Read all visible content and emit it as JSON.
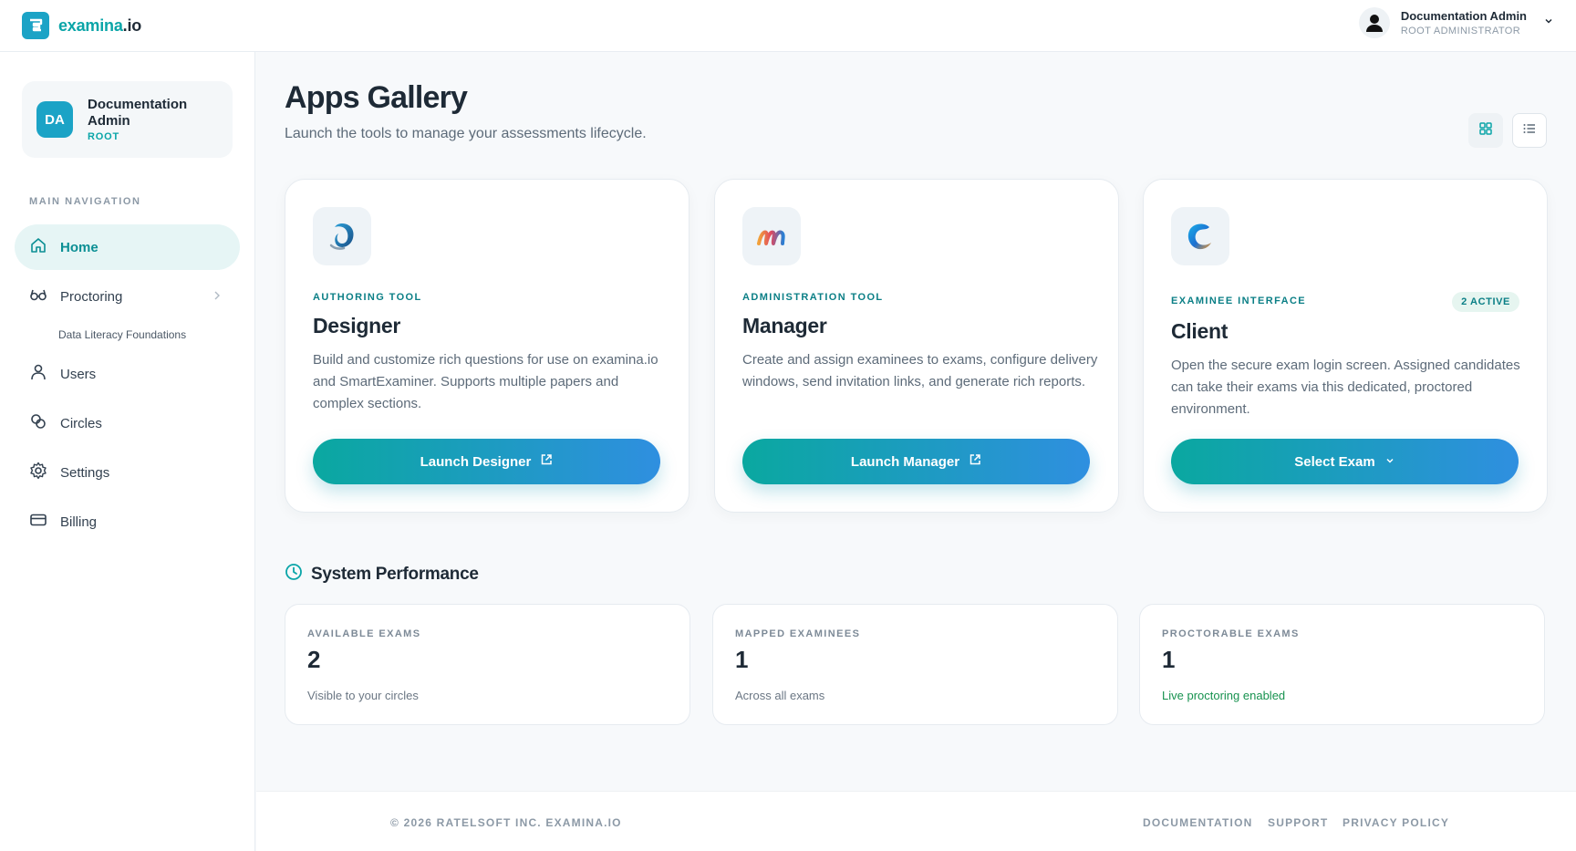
{
  "brand": {
    "name": "examina",
    "tld": ".io",
    "logo_icon": "examina-logo-icon"
  },
  "header": {
    "user_name": "Documentation Admin",
    "user_role": "ROOT ADMINISTRATOR"
  },
  "sidebar": {
    "profile": {
      "initials": "DA",
      "name": "Documentation Admin",
      "role": "ROOT"
    },
    "nav_heading": "MAIN NAVIGATION",
    "items": [
      {
        "label": "Home",
        "icon": "home-icon",
        "active": true
      },
      {
        "label": "Proctoring",
        "icon": "glasses-icon"
      },
      {
        "label": "Users",
        "icon": "user-icon"
      },
      {
        "label": "Circles",
        "icon": "circles-icon"
      },
      {
        "label": "Settings",
        "icon": "gear-icon"
      },
      {
        "label": "Billing",
        "icon": "credit-card-icon"
      }
    ],
    "proctoring_sub": "Data Literacy Foundations"
  },
  "main": {
    "title": "Apps Gallery",
    "subtitle": "Launch the tools to manage your assessments lifecycle.",
    "apps": [
      {
        "kicker": "AUTHORING TOOL",
        "title": "Designer",
        "description": "Build and customize rich questions for use on examina.io and SmartExaminer. Supports multiple papers and complex sections.",
        "button": "Launch Designer"
      },
      {
        "kicker": "ADMINISTRATION TOOL",
        "title": "Manager",
        "description": "Create and assign examinees to exams, configure delivery windows, send invitation links, and generate rich reports.",
        "button": "Launch Manager"
      },
      {
        "kicker": "EXAMINEE INTERFACE",
        "title": "Client",
        "badge": "2 ACTIVE",
        "description": "Open the secure exam login screen. Assigned candidates can take their exams via this dedicated, proctored environment.",
        "button": "Select Exam"
      }
    ],
    "performance_title": "System Performance",
    "stats": [
      {
        "label": "AVAILABLE EXAMS",
        "value": "2",
        "note": "Visible to your circles"
      },
      {
        "label": "MAPPED EXAMINEES",
        "value": "1",
        "note": "Across all exams"
      },
      {
        "label": "PROCTORABLE EXAMS",
        "value": "1",
        "note": "Live proctoring enabled"
      }
    ]
  },
  "footer": {
    "copyright": "© 2026 RATELSOFT INC. EXAMINA.IO",
    "links": [
      "DOCUMENTATION",
      "SUPPORT",
      "PRIVACY POLICY"
    ]
  },
  "colors": {
    "accent": "#0aa5a8",
    "gradient_start": "#0aa8a0",
    "gradient_end": "#2f8fe0",
    "success": "#17924f"
  }
}
